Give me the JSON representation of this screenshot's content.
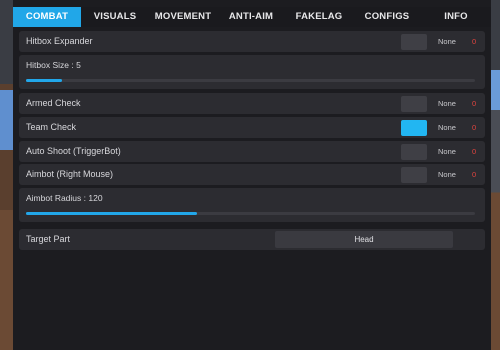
{
  "tabs": [
    "COMBAT",
    "VISUALS",
    "MOVEMENT",
    "ANTI-AIM",
    "FAKELAG",
    "CONFIGS",
    "INFO"
  ],
  "active_tab": "COMBAT",
  "combat": {
    "hitbox_expander": {
      "label": "Hitbox Expander",
      "enabled": false,
      "keybind": "None",
      "value": "0"
    },
    "hitbox_size": {
      "label": "Hitbox Size : 5",
      "value": 5,
      "fill": 0.08
    },
    "armed_check": {
      "label": "Armed Check",
      "enabled": false,
      "keybind": "None",
      "value": "0"
    },
    "team_check": {
      "label": "Team Check",
      "enabled": true,
      "keybind": "None",
      "value": "0"
    },
    "auto_shoot": {
      "label": "Auto Shoot (TriggerBot)",
      "enabled": false,
      "keybind": "None",
      "value": "0"
    },
    "aimbot": {
      "label": "Aimbot (Right Mouse)",
      "enabled": false,
      "keybind": "None",
      "value": "0"
    },
    "aimbot_radius": {
      "label": "Aimbot Radius : 120",
      "value": 120,
      "fill": 0.38
    },
    "target_part": {
      "label": "Target Part",
      "selected": "Head"
    }
  },
  "colors": {
    "accent": "#21a7e8",
    "toggle_on": "#22b6f2",
    "value_red": "#e0443f"
  }
}
